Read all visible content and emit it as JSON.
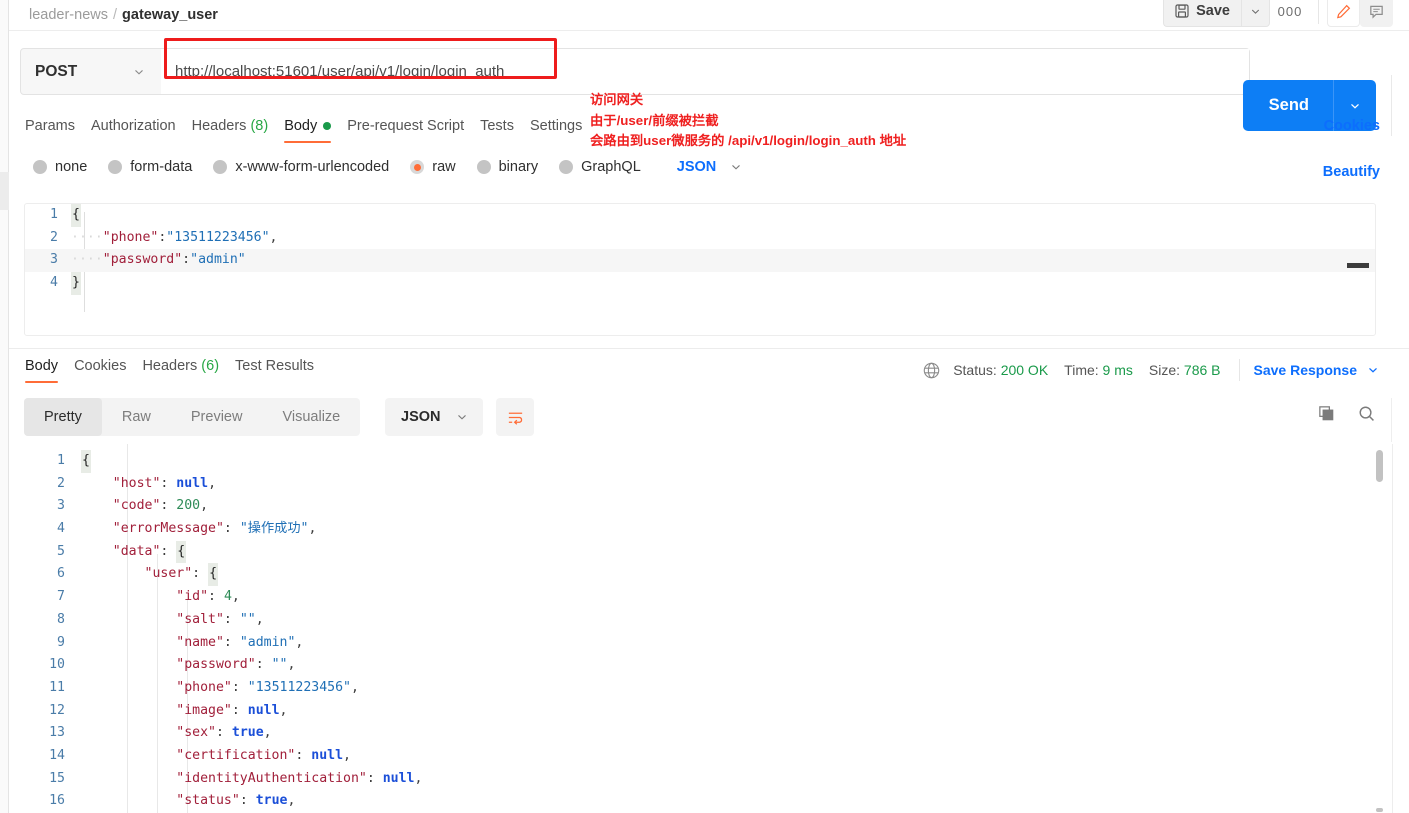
{
  "breadcrumb": {
    "collection": "leader-news",
    "separator": "/",
    "current": "gateway_user"
  },
  "header_actions": {
    "save_label": "Save",
    "save_icon": "floppy-disk-icon",
    "save_caret_icon": "chevron-down-icon",
    "more_label": "000",
    "edit_icon": "pencil-icon",
    "comment_icon": "comment-icon"
  },
  "request": {
    "method": "POST",
    "method_caret": "chevron-down-icon",
    "url": "http://localhost:51601/user/api/v1/login/login_auth",
    "send_label": "Send",
    "send_caret": "chevron-down-icon",
    "annotation": [
      "访问网关",
      "由于/user/前缀被拦截",
      "会路由到user微服务的 /api/v1/login/login_auth 地址"
    ],
    "tabs": [
      {
        "label": "Params",
        "count": "",
        "active": false
      },
      {
        "label": "Authorization",
        "count": "",
        "active": false
      },
      {
        "label": "Headers",
        "count": "(8)",
        "active": false
      },
      {
        "label": "Body",
        "count": "",
        "active": true,
        "dot": true
      },
      {
        "label": "Pre-request Script",
        "count": "",
        "active": false
      },
      {
        "label": "Tests",
        "count": "",
        "active": false
      },
      {
        "label": "Settings",
        "count": "",
        "active": false
      }
    ],
    "cookies_link": "Cookies",
    "body_types": [
      {
        "label": "none",
        "selected": false
      },
      {
        "label": "form-data",
        "selected": false
      },
      {
        "label": "x-www-form-urlencoded",
        "selected": false
      },
      {
        "label": "raw",
        "selected": true
      },
      {
        "label": "binary",
        "selected": false
      },
      {
        "label": "GraphQL",
        "selected": false
      }
    ],
    "format": "JSON",
    "format_caret": "chevron-down-icon",
    "beautify_link": "Beautify",
    "body_lines": [
      {
        "no": "1",
        "text": "{",
        "highlight": false
      },
      {
        "no": "2",
        "text": "    \"phone\":\"13511223456\",",
        "highlight": false
      },
      {
        "no": "3",
        "text": "    \"password\":\"admin\"",
        "highlight": true
      },
      {
        "no": "4",
        "text": "}",
        "highlight": false
      }
    ]
  },
  "response": {
    "tabs": [
      {
        "label": "Body",
        "count": "",
        "active": true
      },
      {
        "label": "Cookies",
        "count": "",
        "active": false
      },
      {
        "label": "Headers",
        "count": "(6)",
        "active": false
      },
      {
        "label": "Test Results",
        "count": "",
        "active": false
      }
    ],
    "globe_icon": "globe-icon",
    "status_label": "Status:",
    "status_value": "200 OK",
    "time_label": "Time:",
    "time_value": "9 ms",
    "size_label": "Size:",
    "size_value": "786 B",
    "save_response_label": "Save Response",
    "save_response_caret": "chevron-down-icon",
    "view_modes": [
      {
        "label": "Pretty",
        "active": true
      },
      {
        "label": "Raw",
        "active": false
      },
      {
        "label": "Preview",
        "active": false
      },
      {
        "label": "Visualize",
        "active": false
      }
    ],
    "format": "JSON",
    "format_caret": "chevron-down-icon",
    "wrap_icon": "word-wrap-icon",
    "copy_icon": "copy-icon",
    "search_icon": "search-icon",
    "body_lines": [
      {
        "no": "1",
        "text": "{"
      },
      {
        "no": "2",
        "text": "    \"host\": null,"
      },
      {
        "no": "3",
        "text": "    \"code\": 200,"
      },
      {
        "no": "4",
        "text": "    \"errorMessage\": \"操作成功\","
      },
      {
        "no": "5",
        "text": "    \"data\": {"
      },
      {
        "no": "6",
        "text": "        \"user\": {"
      },
      {
        "no": "7",
        "text": "            \"id\": 4,"
      },
      {
        "no": "8",
        "text": "            \"salt\": \"\","
      },
      {
        "no": "9",
        "text": "            \"name\": \"admin\","
      },
      {
        "no": "10",
        "text": "            \"password\": \"\","
      },
      {
        "no": "11",
        "text": "            \"phone\": \"13511223456\","
      },
      {
        "no": "12",
        "text": "            \"image\": null,"
      },
      {
        "no": "13",
        "text": "            \"sex\": true,"
      },
      {
        "no": "14",
        "text": "            \"certification\": null,"
      },
      {
        "no": "15",
        "text": "            \"identityAuthentication\": null,"
      },
      {
        "no": "16",
        "text": "            \"status\": true,"
      }
    ]
  },
  "colors": {
    "accent_orange": "#ff6c37",
    "link_blue": "#0d6efd",
    "send_blue": "#0d7ef5",
    "success_green": "#1a9a4a",
    "annotation_red": "#ef2020"
  }
}
